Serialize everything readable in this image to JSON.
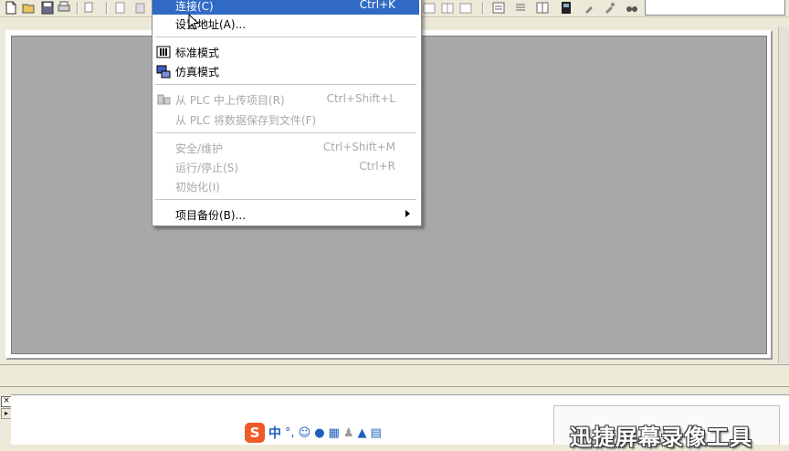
{
  "toolbar": {
    "icons": [
      "new-file-icon",
      "open-folder-icon",
      "save-icon",
      "print-icon",
      "copy-icon",
      "cut-icon",
      "paste-icon",
      "undo-icon",
      "redo-icon",
      "tile-icon",
      "cascade-icon",
      "list-icon",
      "table-icon",
      "device-icon",
      "tool-icon",
      "tool2-icon",
      "binoculars-icon"
    ]
  },
  "menu": {
    "items": [
      {
        "label": "连接(C)",
        "shortcut": "Ctrl+K",
        "state": "highlighted"
      },
      {
        "label": "设置地址(A)...",
        "shortcut": "",
        "state": "enabled"
      },
      {
        "label": "标准模式",
        "shortcut": "",
        "state": "enabled",
        "icon": "standard-mode-icon"
      },
      {
        "label": "仿真模式",
        "shortcut": "",
        "state": "enabled",
        "icon": "simulation-mode-icon"
      },
      {
        "label": "从 PLC 中上传项目(R)",
        "shortcut": "Ctrl+Shift+L",
        "state": "disabled",
        "icon": "upload-icon"
      },
      {
        "label": "从 PLC 将数据保存到文件(F)",
        "shortcut": "",
        "state": "disabled"
      },
      {
        "label": "安全/维护",
        "shortcut": "Ctrl+Shift+M",
        "state": "disabled"
      },
      {
        "label": "运行/停止(S)",
        "shortcut": "Ctrl+R",
        "state": "disabled"
      },
      {
        "label": "初始化(I)",
        "shortcut": "",
        "state": "disabled"
      },
      {
        "label": "项目备份(B)...",
        "shortcut": "",
        "state": "enabled",
        "submenu": true
      }
    ]
  },
  "bottom": {
    "close_glyph": "×",
    "ime_logo": "S",
    "ime_lang": "中",
    "ime_punct": "°,",
    "watermark": "迅捷屏幕录像工具"
  },
  "colors": {
    "highlight": "#316ac5",
    "disabled": "#a9a9a9",
    "workspace": "#a8a8a8"
  }
}
